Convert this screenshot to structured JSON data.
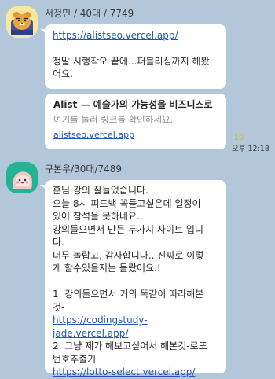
{
  "messages": [
    {
      "sender": "서정민 / 40대 / 7749",
      "url": "https://alistseo.vercel.app/",
      "text_lines": [
        "정말 시행착오 끝에...퍼블리싱까지 해봤",
        "어요."
      ],
      "preview": {
        "title": "Alist — 예술가의 가능성을 비즈니스로",
        "subtitle": "여기를 눌러 링크를 확인하세요.",
        "domain": "alistseo.vercel.app"
      },
      "unread_count": "10",
      "time": "오후 12:18"
    },
    {
      "sender": "구본우/30대/7489",
      "lines": [
        "훈님 강의 잘들었습니다.",
        "오늘 8시 피드백 꼭듣고싶은데 일정이",
        "있어 참석을 못하네요..",
        "강의들으면서 만든 두가지 사이트 입니",
        "다.",
        "너무 놀랍고, 감사합니다.. 진짜로 이렇",
        "게 할수있을지는 몰랐어요.!",
        "",
        "1. 강의들으면서 거의 똑같이 따라해본",
        "것-"
      ],
      "link1": "https://codingstudy-jade.vercel.app/",
      "line_after_link1_a": "2. 그냥 제가 해보고싶어서 해본것-로또",
      "line_after_link1_b": "번호추출기",
      "link2": "https://lotto-select.vercel.app/"
    }
  ],
  "icons": {
    "avatar1": "ryan-kakao-avatar-icon",
    "avatar2": "pink-character-avatar-icon"
  },
  "colors": {
    "background": "#b2c7d9",
    "bubble": "#ffffff",
    "link": "#2454b8",
    "unread": "#e4b50e"
  }
}
